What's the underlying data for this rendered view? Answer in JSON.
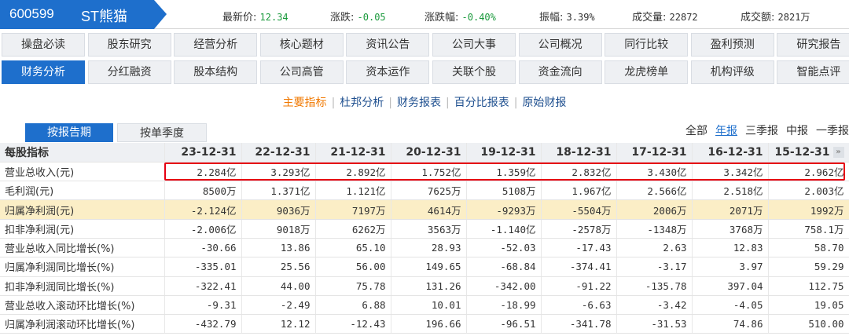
{
  "stock": {
    "code": "600599",
    "name": "ST熊猫"
  },
  "quote": [
    {
      "label": "最新价:",
      "value": "12.34",
      "color": "#1a9a3c"
    },
    {
      "label": "涨跌:",
      "value": "-0.05",
      "color": "#1a9a3c"
    },
    {
      "label": "涨跌幅:",
      "value": "-0.40%",
      "color": "#1a9a3c"
    },
    {
      "label": "振幅:",
      "value": "3.39%",
      "color": "#333333"
    },
    {
      "label": "成交量:",
      "value": "22872",
      "color": "#333333"
    },
    {
      "label": "成交额:",
      "value": "2821万",
      "color": "#333333"
    }
  ],
  "nav_rows": [
    [
      "操盘必读",
      "股东研究",
      "经营分析",
      "核心题材",
      "资讯公告",
      "公司大事",
      "公司概况",
      "同行比较",
      "盈利预测",
      "研究报告"
    ],
    [
      "财务分析",
      "分红融资",
      "股本结构",
      "公司高管",
      "资本运作",
      "关联个股",
      "资金流向",
      "龙虎榜单",
      "机构评级",
      "智能点评"
    ]
  ],
  "active_nav": "财务分析",
  "subtabs": [
    "主要指标",
    "杜邦分析",
    "财务报表",
    "百分比报表",
    "原始财报"
  ],
  "active_subtab": "主要指标",
  "period": {
    "by_report": "按报告期",
    "by_quarter": "按单季度"
  },
  "filters": [
    "全部",
    "年报",
    "三季报",
    "中报",
    "一季报"
  ],
  "active_filter": "年报",
  "table": {
    "header": "每股指标",
    "columns": [
      "23-12-31",
      "22-12-31",
      "21-12-31",
      "20-12-31",
      "19-12-31",
      "18-12-31",
      "17-12-31",
      "16-12-31",
      "15-12-31"
    ],
    "rows": [
      {
        "label": "营业总收入(元)",
        "values": [
          "2.284亿",
          "3.293亿",
          "2.892亿",
          "1.752亿",
          "1.359亿",
          "2.832亿",
          "3.430亿",
          "3.342亿",
          "2.962亿"
        ],
        "boxed": true
      },
      {
        "label": "毛利润(元)",
        "values": [
          "8500万",
          "1.371亿",
          "1.121亿",
          "7625万",
          "5108万",
          "1.967亿",
          "2.566亿",
          "2.518亿",
          "2.003亿"
        ]
      },
      {
        "label": "归属净利润(元)",
        "values": [
          "-2.124亿",
          "9036万",
          "7197万",
          "4614万",
          "-9293万",
          "-5504万",
          "2006万",
          "2071万",
          "1992万"
        ],
        "highlight": true
      },
      {
        "label": "扣非净利润(元)",
        "values": [
          "-2.006亿",
          "9018万",
          "6262万",
          "3563万",
          "-1.140亿",
          "-2578万",
          "-1348万",
          "3768万",
          "758.1万"
        ]
      },
      {
        "label": "营业总收入同比增长(%)",
        "values": [
          "-30.66",
          "13.86",
          "65.10",
          "28.93",
          "-52.03",
          "-17.43",
          "2.63",
          "12.83",
          "58.70"
        ]
      },
      {
        "label": "归属净利润同比增长(%)",
        "values": [
          "-335.01",
          "25.56",
          "56.00",
          "149.65",
          "-68.84",
          "-374.41",
          "-3.17",
          "3.97",
          "59.29"
        ]
      },
      {
        "label": "扣非净利润同比增长(%)",
        "values": [
          "-322.41",
          "44.00",
          "75.78",
          "131.26",
          "-342.00",
          "-91.22",
          "-135.78",
          "397.04",
          "112.75"
        ]
      },
      {
        "label": "营业总收入滚动环比增长(%)",
        "values": [
          "-9.31",
          "-2.49",
          "6.88",
          "10.01",
          "-18.99",
          "-6.63",
          "-3.42",
          "-4.05",
          "19.05"
        ]
      },
      {
        "label": "归属净利润滚动环比增长(%)",
        "values": [
          "-432.79",
          "12.12",
          "-12.43",
          "196.66",
          "-96.51",
          "-341.78",
          "-31.53",
          "74.86",
          "510.00"
        ]
      }
    ]
  },
  "colors": {
    "accent": "#1e6fcc",
    "highlight_row": "#fbeec6",
    "box": "#e60012",
    "down": "#1a9a3c",
    "subtab_active": "#f07800"
  }
}
